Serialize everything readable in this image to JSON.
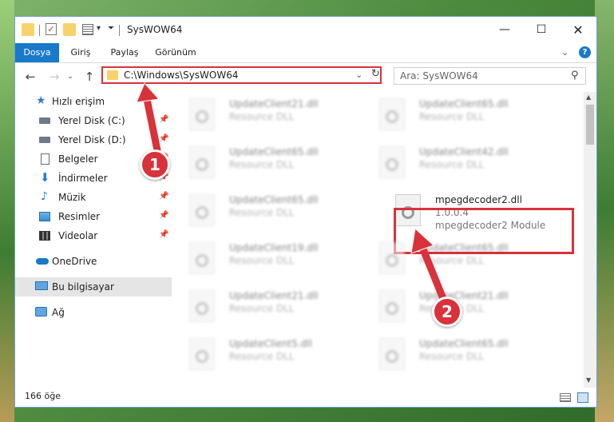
{
  "window": {
    "title": "SysWOW64"
  },
  "ribbon": {
    "tabs": [
      "Dosya",
      "Giriş",
      "Paylaş",
      "Görünüm"
    ]
  },
  "address": {
    "path": "C:\\Windows\\SysWOW64"
  },
  "search": {
    "placeholder": "Ara: SysWOW64"
  },
  "sidebar": {
    "items": [
      {
        "label": "Hızlı erişim",
        "icon": "star-icon"
      },
      {
        "label": "Yerel Disk (C:)",
        "icon": "drive-icon",
        "pinned": true
      },
      {
        "label": "Yerel Disk (D:)",
        "icon": "drive-icon",
        "pinned": true
      },
      {
        "label": "Belgeler",
        "icon": "document-icon",
        "pinned": true
      },
      {
        "label": "İndirmeler",
        "icon": "download-icon",
        "pinned": true
      },
      {
        "label": "Müzik",
        "icon": "music-icon",
        "pinned": true
      },
      {
        "label": "Resimler",
        "icon": "pictures-icon",
        "pinned": true
      },
      {
        "label": "Videolar",
        "icon": "video-icon",
        "pinned": true
      },
      {
        "label": "OneDrive",
        "icon": "cloud-icon"
      },
      {
        "label": "Bu bilgisayar",
        "icon": "computer-icon",
        "selected": true
      },
      {
        "label": "Ağ",
        "icon": "network-icon"
      }
    ]
  },
  "files": [
    {
      "name": "UpdateClient21.dll",
      "type": "Resource DLL",
      "blurred": true
    },
    {
      "name": "UpdateClient65.dll",
      "type": "Resource DLL",
      "blurred": true
    },
    {
      "name": "UpdateClient65.dll",
      "type": "Resource DLL",
      "blurred": true
    },
    {
      "name": "UpdateClient42.dll",
      "type": "Resource DLL",
      "blurred": true
    },
    {
      "name": "UpdateClient65.dll",
      "type": "Resource DLL",
      "blurred": true
    },
    {
      "name": "mpegdecoder2.dll",
      "version": "1.0.0.4",
      "type": "mpegdecoder2 Module",
      "blurred": false
    },
    {
      "name": "UpdateClient19.dll",
      "type": "Resource DLL",
      "blurred": true
    },
    {
      "name": "UpdateClient65.dll",
      "type": "Resource DLL",
      "blurred": true
    },
    {
      "name": "UpdateClient21.dll",
      "type": "Resource DLL",
      "blurred": true
    },
    {
      "name": "UpdateClient21.dll",
      "type": "Resource DLL",
      "blurred": true
    },
    {
      "name": "UpdateClient5.dll",
      "type": "Resource DLL",
      "blurred": true
    },
    {
      "name": "UpdateClient65.dll",
      "type": "Resource DLL",
      "blurred": true
    }
  ],
  "status": {
    "item_count": "166 öğe"
  },
  "callouts": [
    "1",
    "2"
  ],
  "colors": {
    "accent": "#1979ca",
    "highlight": "#d9323a",
    "selected_bg": "#e5e5e5"
  }
}
